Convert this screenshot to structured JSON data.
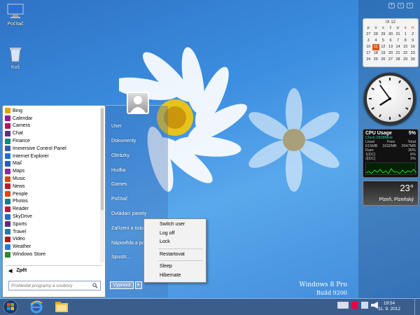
{
  "desktop": {
    "icons": [
      {
        "label": "Počítač",
        "icon": "computer-icon"
      },
      {
        "label": "Koš",
        "icon": "recycle-bin-icon"
      }
    ]
  },
  "start_menu": {
    "apps": [
      {
        "label": "Bing",
        "icon": "bing-icon",
        "color": "#e8a000"
      },
      {
        "label": "Calendar",
        "icon": "calendar-icon",
        "color": "#8e1b8e"
      },
      {
        "label": "Camera",
        "icon": "camera-icon",
        "color": "#b0195e"
      },
      {
        "label": "Chat",
        "icon": "chat-icon",
        "color": "#5b2c8a"
      },
      {
        "label": "Finance",
        "icon": "finance-icon",
        "color": "#0e8a7a"
      },
      {
        "label": "Immersive Control Panel",
        "icon": "control-panel-icon",
        "color": "#2d5fa8"
      },
      {
        "label": "Internet Explorer",
        "icon": "internet-explorer-icon",
        "color": "#1a6ed8"
      },
      {
        "label": "Mail",
        "icon": "mail-icon",
        "color": "#1f5fb5"
      },
      {
        "label": "Maps",
        "icon": "maps-icon",
        "color": "#8a2a9a"
      },
      {
        "label": "Music",
        "icon": "music-icon",
        "color": "#d24a10"
      },
      {
        "label": "News",
        "icon": "news-icon",
        "color": "#b81c2c"
      },
      {
        "label": "People",
        "icon": "people-icon",
        "color": "#d94a0b"
      },
      {
        "label": "Photos",
        "icon": "photos-icon",
        "color": "#0d7f8c"
      },
      {
        "label": "Reader",
        "icon": "reader-icon",
        "color": "#b8183a"
      },
      {
        "label": "SkyDrive",
        "icon": "skydrive-icon",
        "color": "#1b6ec2"
      },
      {
        "label": "Sports",
        "icon": "sports-icon",
        "color": "#5a2a8a"
      },
      {
        "label": "Travel",
        "icon": "travel-icon",
        "color": "#1b7fa8"
      },
      {
        "label": "Video",
        "icon": "video-icon",
        "color": "#b01a1a"
      },
      {
        "label": "Weather",
        "icon": "weather-icon",
        "color": "#2a7ad6"
      },
      {
        "label": "Windows Store",
        "icon": "store-icon",
        "color": "#2a8a2a"
      }
    ],
    "back_label": "Zpět",
    "search_placeholder": "Prohledat programy a soubory",
    "right_links": [
      "User",
      "Dokumenty",
      "Obrázky",
      "Hudba",
      "Games",
      "Počítač",
      "Ovládací panely",
      "Zařízení a tiská",
      "Nápověda a po",
      "Spustit..."
    ],
    "shutdown_label": "Vypnout"
  },
  "context_menu": {
    "groups": [
      [
        "Switch user",
        "Log off",
        "Lock"
      ],
      [
        "Restartovat"
      ],
      [
        "Sleep",
        "Hibernate"
      ]
    ]
  },
  "watermark": {
    "line1": "Windows 8 Pro",
    "line2": "Build 9200"
  },
  "gadgets": {
    "calendar": {
      "month_label": "IX 12",
      "weekdays": [
        "p",
        "ú",
        "s",
        "č",
        "p",
        "s",
        "n"
      ],
      "days": [
        "27",
        "28",
        "29",
        "30",
        "31",
        "1",
        "2",
        "3",
        "4",
        "5",
        "6",
        "7",
        "8",
        "9",
        "10",
        "11",
        "12",
        "13",
        "14",
        "15",
        "16",
        "17",
        "18",
        "19",
        "20",
        "21",
        "22",
        "23",
        "24",
        "25",
        "26",
        "27",
        "28",
        "29",
        "30"
      ],
      "today": "11"
    },
    "clock": {
      "hours": 7,
      "minutes": 54
    },
    "cpu": {
      "title": "CPU Usage",
      "percent": "5%",
      "clock": "Clock:2508MHz",
      "mem_headers": [
        "Used",
        "Free",
        "Total"
      ],
      "mem_values": [
        "615MB",
        "1632MB",
        "2047MB"
      ],
      "ram_label": "Ram",
      "ram_pct": "30%",
      "cores": [
        {
          "label": "1[DC]",
          "value": "6%"
        },
        {
          "label": "2[DC]",
          "value": "3%"
        }
      ]
    },
    "weather": {
      "temp": "23°",
      "city": "Plzeň, Plzeňský"
    }
  },
  "taskbar": {
    "time": "19:54",
    "date": "11. 9. 2012"
  }
}
